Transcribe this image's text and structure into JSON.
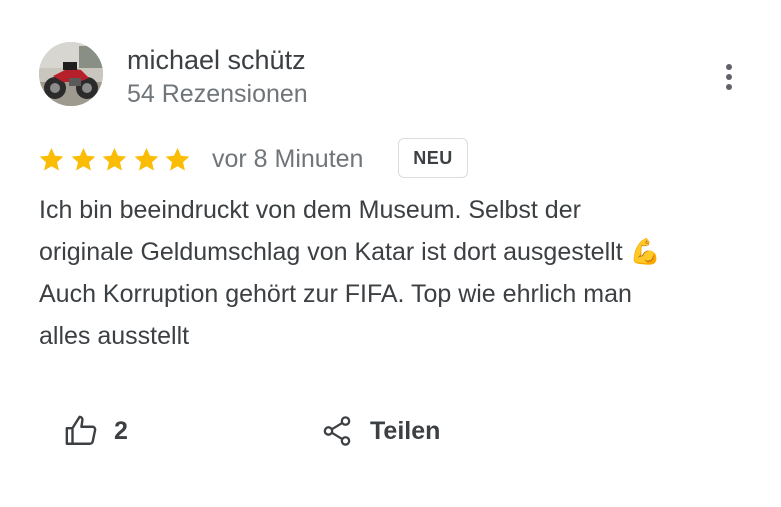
{
  "reviewer": {
    "name": "michael schütz",
    "reviews_count": "54 Rezensionen",
    "avatar_icon": "motorcycle-avatar"
  },
  "menu": {
    "icon": "more-vert-icon"
  },
  "rating": {
    "stars": 5,
    "max": 5,
    "star_color": "#fbbc04"
  },
  "meta": {
    "time": "vor 8 Minuten",
    "badge": "NEU"
  },
  "review": {
    "lines": [
      "Ich bin beeindruckt von dem Museum. Selbst der",
      "originale Geldumschlag von Katar ist dort ausgestellt 💪",
      "Auch Korruption gehört zur FIFA. Top wie ehrlich man",
      "alles ausstellt"
    ]
  },
  "actions": {
    "like_count": "2",
    "share_label": "Teilen",
    "like_icon": "thumbs-up-icon",
    "share_icon": "share-icon"
  }
}
